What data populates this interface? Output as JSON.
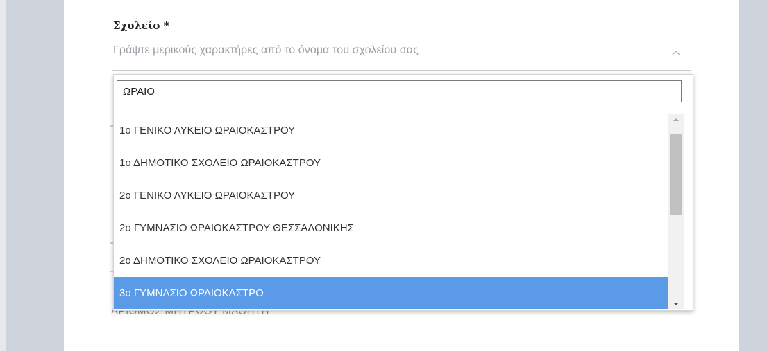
{
  "form": {
    "school_label": "Σχολείο *",
    "school_placeholder": "Γράψτε μερικούς χαρακτήρες από το όνομα του σχολείου σας",
    "behind_field_label": "ΑΡΙΘΜΟΣ ΜΗΤΡΩΟΥ ΜΑΘΗΤΗ"
  },
  "dropdown": {
    "search_value": "ΩΡΑΙΟ",
    "items": [
      "1ο ΓΕΝΙΚΟ ΛΥΚΕΙΟ ΩΡΑΙΟΚΑΣΤΡΟΥ",
      "1ο ΔΗΜΟΤΙΚΟ ΣΧΟΛΕΙΟ ΩΡΑΙΟΚΑΣΤΡΟΥ",
      "2ο ΓΕΝΙΚΟ ΛΥΚΕΙΟ ΩΡΑΙΟΚΑΣΤΡΟΥ",
      "2ο ΓΥΜΝΑΣΙΟ ΩΡΑΙΟΚΑΣΤΡΟΥ ΘΕΣΣΑΛΟΝΙΚΗΣ",
      "2ο ΔΗΜΟΤΙΚΟ ΣΧΟΛΕΙΟ ΩΡΑΙΟΚΑΣΤΡΟΥ",
      "3ο ΓΥΜΝΑΣΙΟ ΩΡΑΙΟΚΑΣΤΡΟ"
    ],
    "selected_index": 5,
    "highlight_color": "#5b9ae6"
  },
  "icons": {
    "field_toggle": "chevron-up-icon",
    "scroll_up": "scroll-up-arrow-icon",
    "scroll_down": "scroll-down-arrow-icon"
  }
}
